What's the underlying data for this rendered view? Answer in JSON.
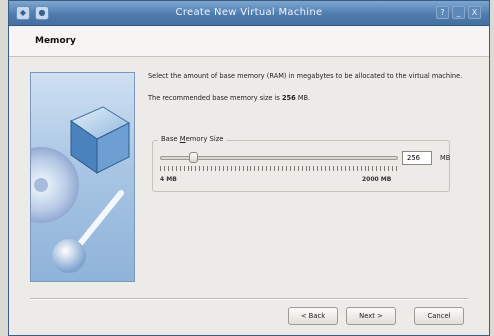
{
  "window": {
    "title": "Create New Virtual Machine",
    "controls": {
      "help": "?",
      "minimize": "_",
      "close": "X"
    }
  },
  "page": {
    "heading": "Memory"
  },
  "content": {
    "description": "Select the amount of base memory (RAM) in megabytes to be allocated to the virtual machine.",
    "recommended_prefix": "The recommended base memory size is ",
    "recommended_value": "256",
    "recommended_suffix": " MB."
  },
  "memory": {
    "group_label_pre": "Base ",
    "group_label_accel": "M",
    "group_label_post": "emory Size",
    "value": "256",
    "unit": "MB",
    "min_label": "4 MB",
    "max_label": "2000 MB",
    "slider_fraction": 0.126
  },
  "buttons": {
    "back": "< Back",
    "next": "Next >",
    "cancel": "Cancel"
  }
}
